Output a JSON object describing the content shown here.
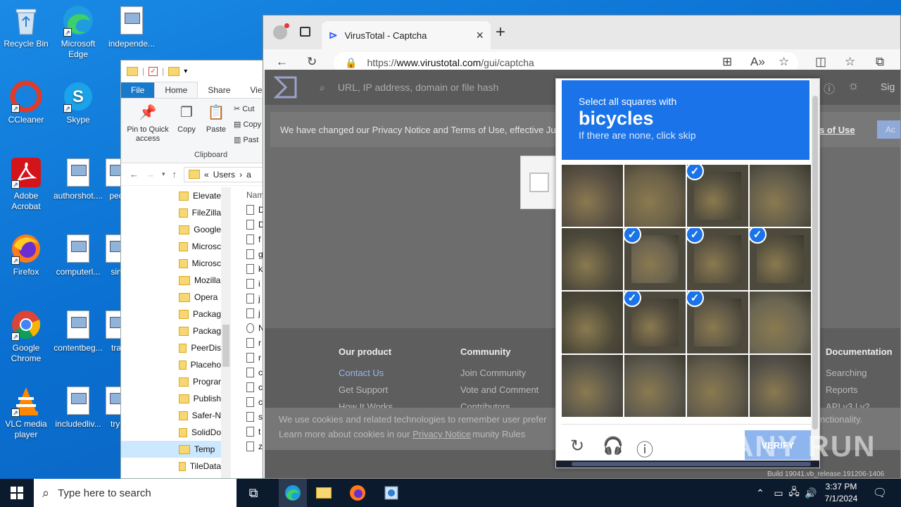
{
  "desktop": {
    "icons": [
      {
        "label": "Recycle Bin",
        "icon": "recycle-bin-icon"
      },
      {
        "label": "Microsoft Edge",
        "icon": "edge-icon"
      },
      {
        "label": "independe...",
        "icon": "document-icon"
      },
      {
        "label": "CCleaner",
        "icon": "ccleaner-icon"
      },
      {
        "label": "Skype",
        "icon": "skype-icon"
      },
      {
        "label": "Adobe Acrobat",
        "icon": "acrobat-icon"
      },
      {
        "label": "authorshot....",
        "icon": "document-icon"
      },
      {
        "label": "pec",
        "icon": "document-icon"
      },
      {
        "label": "Firefox",
        "icon": "firefox-icon"
      },
      {
        "label": "computerl...",
        "icon": "document-icon"
      },
      {
        "label": "sin",
        "icon": "document-icon"
      },
      {
        "label": "Google Chrome",
        "icon": "chrome-icon"
      },
      {
        "label": "contentbeg...",
        "icon": "document-icon"
      },
      {
        "label": "tra",
        "icon": "document-icon"
      },
      {
        "label": "VLC media player",
        "icon": "vlc-icon"
      },
      {
        "label": "includedliv...",
        "icon": "document-icon"
      },
      {
        "label": "tryi",
        "icon": "document-icon"
      }
    ]
  },
  "explorer": {
    "tabs": [
      "File",
      "Home",
      "Share",
      "Vie"
    ],
    "ribbon": {
      "pin": "Pin to Quick access",
      "copy": "Copy",
      "paste": "Paste",
      "cut": "Cut",
      "copy_path": "Copy",
      "paste_shortcut": "Past",
      "group": "Clipboard"
    },
    "breadcrumb": [
      "«",
      "Users",
      "a"
    ],
    "nav_items": [
      "Elevate",
      "FileZilla",
      "Google",
      "Microsc",
      "Microsc",
      "Mozilla",
      "Opera",
      "Packag",
      "Packag",
      "PeerDis",
      "Placeho",
      "Prograr",
      "Publish",
      "Safer-N",
      "SolidDo",
      "Temp",
      "TileData"
    ],
    "selected_item": "Temp",
    "file_header": "Nam",
    "files": [
      "D",
      "D",
      "f",
      "g",
      "k",
      "i",
      "j",
      "j",
      "N",
      "r",
      "r",
      "c",
      "c",
      "c",
      "s",
      "t",
      "z"
    ]
  },
  "browser": {
    "tab_title": "VirusTotal - Captcha",
    "url_prefix": "https://",
    "url_domain": "www.virustotal.com",
    "url_path": "/gui/captcha",
    "new_tab": "+",
    "close_tab": "×"
  },
  "virustotal": {
    "search_placeholder": "URL, IP address, domain or file hash",
    "sign": "Sig",
    "banner": "We have changed our Privacy Notice and Terms of Use, effective Ju",
    "banner_link": "s of Use",
    "banner_btn": "Ac",
    "footer": {
      "product": {
        "heading": "Our product",
        "items": [
          "Contact Us",
          "Get Support",
          "How It Works"
        ]
      },
      "community": {
        "heading": "Community",
        "items": [
          "Join Community",
          "Vote and Comment",
          "Contributors"
        ]
      },
      "documentation": {
        "heading": "Documentation",
        "items": [
          "Searching",
          "Reports",
          "API v3 | v2"
        ]
      }
    },
    "cookie_line1": "We use cookies and related technologies to remember user prefer",
    "cookie_line2a": "Learn more about cookies in our ",
    "cookie_link": "Privacy Notice",
    "cookie_tail": "functionality.",
    "cookie_tail2": "munity Rules"
  },
  "captcha": {
    "instruction": "Select all squares with",
    "keyword": "bicycles",
    "sub": "If there are none, click skip",
    "verify": "VERIFY",
    "selected": [
      2,
      5,
      6,
      7,
      9,
      10
    ],
    "colors": {
      "header": "#1a73e8",
      "check": "#1a73e8",
      "verify": "#8fb5ee"
    }
  },
  "taskbar": {
    "search_placeholder": "Type here to search",
    "time": "3:37 PM",
    "date": "7/1/2024",
    "build": "Build 19041.vb_release.191206-1406"
  },
  "watermark": "ANY RUN"
}
